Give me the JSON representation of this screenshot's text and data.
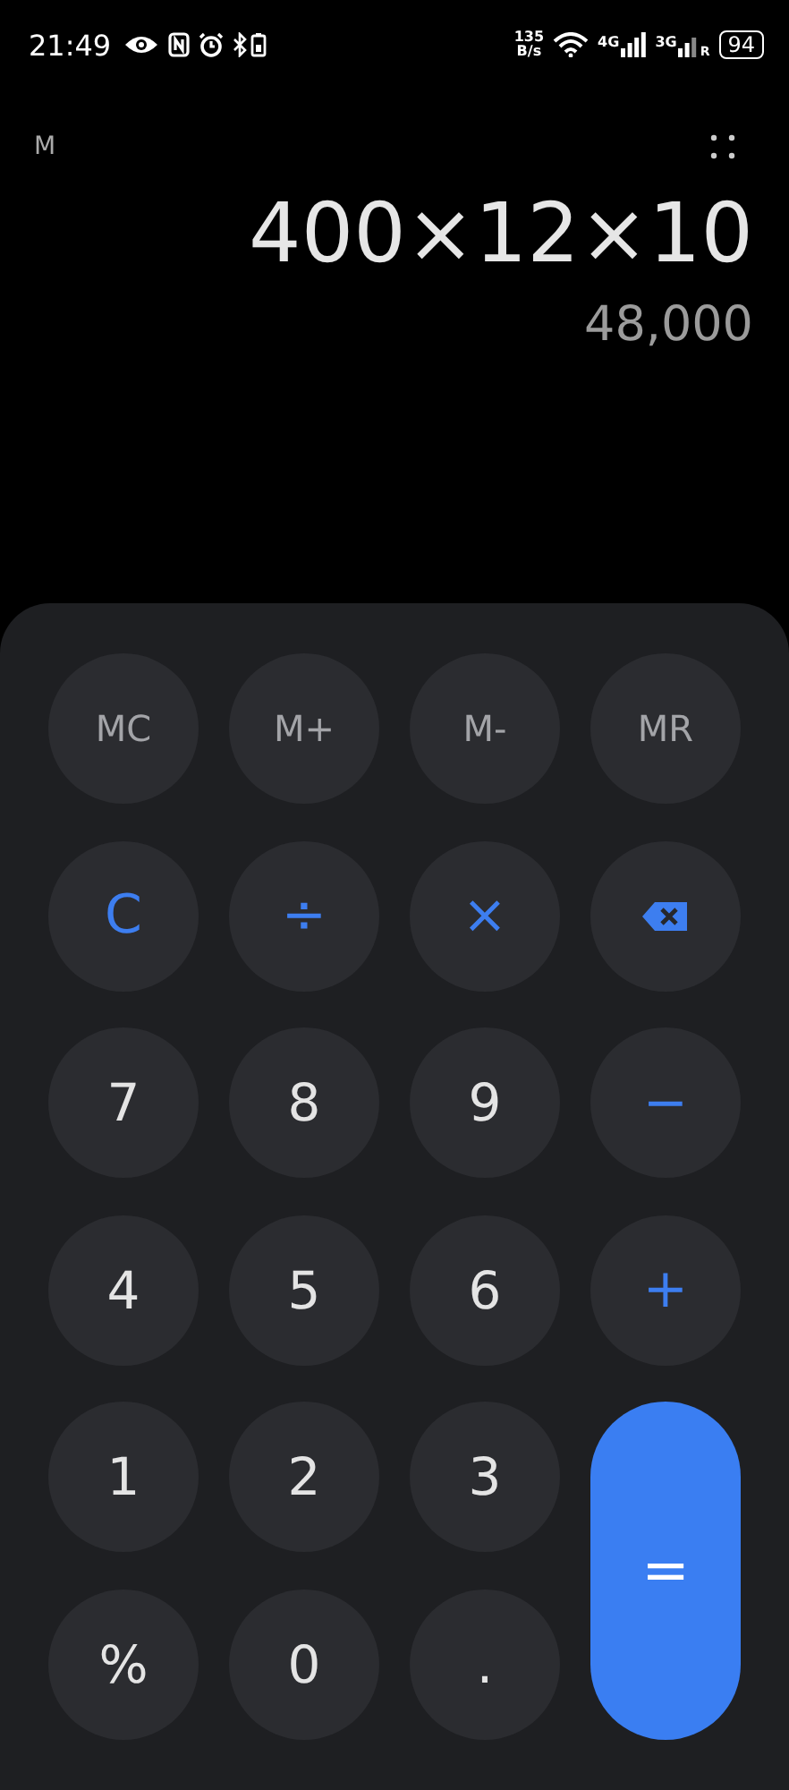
{
  "status_bar": {
    "time": "21:49",
    "net_speed_value": "135",
    "net_speed_unit": "B/s",
    "signal_1": "4G",
    "signal_2": "3G",
    "roaming": "R",
    "battery": "94"
  },
  "memory_indicator": "M",
  "expression": "400×12×10",
  "result": "48,000",
  "keys": [
    {
      "label": "MC",
      "kind": "memory"
    },
    {
      "label": "M+",
      "kind": "memory"
    },
    {
      "label": "M-",
      "kind": "memory"
    },
    {
      "label": "MR",
      "kind": "memory"
    },
    {
      "label": "C",
      "kind": "operator"
    },
    {
      "label": "÷",
      "kind": "operator"
    },
    {
      "label": "×",
      "kind": "operator"
    },
    {
      "kind": "backspace"
    },
    {
      "label": "7",
      "kind": "digit"
    },
    {
      "label": "8",
      "kind": "digit"
    },
    {
      "label": "9",
      "kind": "digit"
    },
    {
      "label": "−",
      "kind": "operator"
    },
    {
      "label": "4",
      "kind": "digit"
    },
    {
      "label": "5",
      "kind": "digit"
    },
    {
      "label": "6",
      "kind": "digit"
    },
    {
      "label": "+",
      "kind": "operator"
    },
    {
      "label": "1",
      "kind": "digit"
    },
    {
      "label": "2",
      "kind": "digit"
    },
    {
      "label": "3",
      "kind": "digit"
    },
    {
      "label": "=",
      "kind": "equals"
    },
    {
      "label": "%",
      "kind": "digit"
    },
    {
      "label": "0",
      "kind": "digit"
    },
    {
      "label": ".",
      "kind": "digit"
    }
  ]
}
